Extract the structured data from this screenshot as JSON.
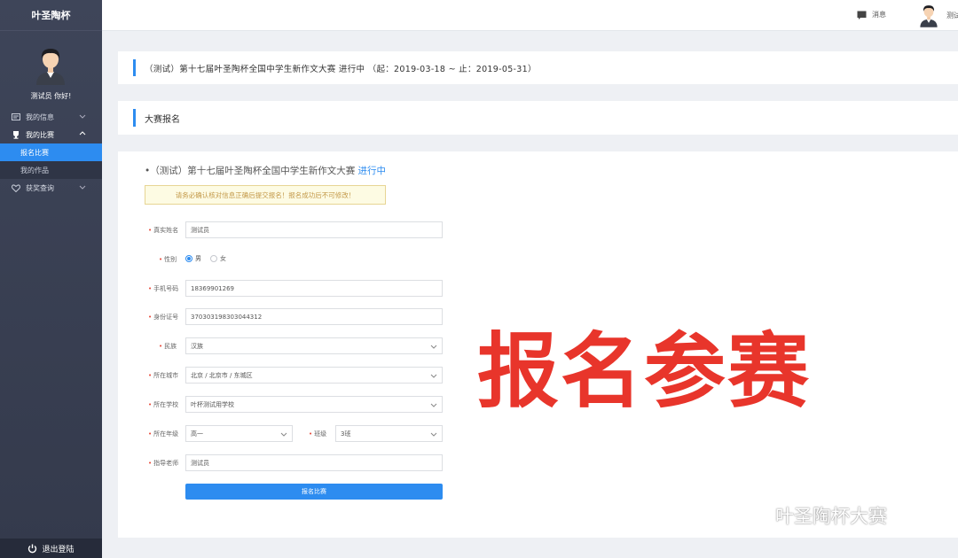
{
  "sidebar": {
    "brand": "叶圣陶杯",
    "greeting": "测试员 你好!",
    "items": [
      {
        "label": "我的信息",
        "icon": "card-icon"
      },
      {
        "label": "我的比赛",
        "icon": "trophy-icon"
      },
      {
        "label": "获奖查询",
        "icon": "heart-icon"
      }
    ],
    "sub_items": [
      {
        "label": "报名比赛",
        "active": true
      },
      {
        "label": "我的作品",
        "active": false
      }
    ],
    "logout": "退出登陆"
  },
  "header": {
    "messages": "消息",
    "user": "测试"
  },
  "banner": {
    "text": "（测试）第十七届叶圣陶杯全国中学生新作文大赛 进行中 （起：2019-03-18 ~ 止：2019-05-31）"
  },
  "section": {
    "title": "大赛报名"
  },
  "form": {
    "competition": "•（测试）第十七届叶圣陶杯全国中学生新作文大赛",
    "status": "进行中",
    "notice": "请务必确认核对信息正确后提交报名！报名成功后不可修改！",
    "fields": {
      "name_label": "真实姓名",
      "name_value": "测试员",
      "gender_label": "性别",
      "gender_male": "男",
      "gender_female": "女",
      "phone_label": "手机号码",
      "phone_value": "18369901269",
      "id_label": "身份证号",
      "id_value": "370303198303044312",
      "ethnicity_label": "民族",
      "ethnicity_value": "汉族",
      "city_label": "所在城市",
      "city_value": "北京 / 北京市 / 东城区",
      "school_label": "所在学校",
      "school_value": "叶杯测试用学校",
      "grade_label": "所在年级",
      "grade_value": "高一",
      "class_label": "班级",
      "class_value": "3班",
      "teacher_label": "指导老师",
      "teacher_value": "测试员"
    },
    "submit": "报名比赛"
  },
  "overlay": {
    "stamp": "报名参赛",
    "watermark": "叶圣陶杯大赛"
  },
  "colors": {
    "accent": "#2d8cf0",
    "sidebar": "#3a4154",
    "stamp": "#e8352b"
  }
}
